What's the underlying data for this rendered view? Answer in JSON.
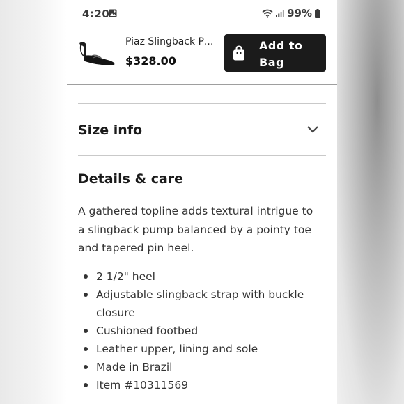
{
  "status_bar": {
    "time": "4:20",
    "battery": "99%"
  },
  "sticky_header": {
    "product_name": "Piaz Slingback Poi...",
    "price": "$328.00",
    "add_button_label": "Add to Bag"
  },
  "sections": {
    "size_info": {
      "title": "Size info"
    },
    "details": {
      "title": "Details & care",
      "description": "A gathered topline adds textural intrigue to a slingback pump balanced by a pointy toe and tapered pin heel.",
      "bullets": [
        "2 1/2\" heel",
        "Adjustable slingback strap with buckle closure",
        "Cushioned footbed",
        "Leather upper, lining and sole",
        "Made in Brazil",
        "Item #10311569"
      ]
    }
  },
  "colors": {
    "button_bg": "#1b1b1b",
    "text": "#333333"
  },
  "icons": [
    "image-icon",
    "wifi-icon",
    "signal-icon",
    "battery-icon",
    "shopping-bag-icon",
    "chevron-down-icon"
  ]
}
